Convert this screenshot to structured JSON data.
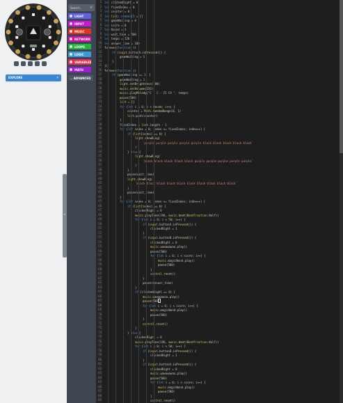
{
  "simulator": {
    "explore_label": "EXPLORE",
    "buttons": [
      "play-icon",
      "stop-icon",
      "restart-icon",
      "mute-icon",
      "fullscreen-icon"
    ],
    "device": "circuit-playground-board"
  },
  "toolbox": {
    "search_placeholder": "Search...",
    "categories": [
      {
        "label": "LIGHT",
        "color": "#6160e5"
      },
      {
        "label": "INPUT",
        "color": "#c41bd1"
      },
      {
        "label": "MUSIC",
        "color": "#e63022"
      },
      {
        "label": "NETWORK",
        "color": "#ce149e"
      },
      {
        "label": "LOOPS",
        "color": "#20b53f"
      },
      {
        "label": "LOGIC",
        "color": "#3e9ad6"
      },
      {
        "label": "VARIABLES",
        "color": "#e62e53"
      },
      {
        "label": "MATH",
        "color": "#9a1fd4"
      }
    ],
    "advanced_label": "ADVANCED"
  },
  "editor": {
    "current_line": 67,
    "code_lines": [
      {
        "indent": 0,
        "text": "let clickedRight = 0"
      },
      {
        "indent": 0,
        "text": "let fixedIndex = 0"
      },
      {
        "indent": 0,
        "text": "let counter = 0"
      },
      {
        "indent": 0,
        "text": "let list: number[] = []"
      },
      {
        "indent": 0,
        "text": "let gameWaiting = 0"
      },
      {
        "indent": 0,
        "text": "let score = 0"
      },
      {
        "indent": 0,
        "text": "let Round = 3"
      },
      {
        "indent": 0,
        "text": "let wait_time = 500"
      },
      {
        "indent": 0,
        "text": "let tempo = 120"
      },
      {
        "indent": 0,
        "text": "let answer_time = 100"
      },
      {
        "indent": 0,
        "text": "forever(function () {"
      },
      {
        "indent": 1,
        "text": "if (input.buttonA.isPressed()) {"
      },
      {
        "indent": 2,
        "text": "gameWaiting = 1"
      },
      {
        "indent": 1,
        "text": "}"
      },
      {
        "indent": 0,
        "text": "})"
      },
      {
        "indent": 0,
        "text": "forever(function () {"
      },
      {
        "indent": 1,
        "text": "if (gameWaiting == 1) {"
      },
      {
        "indent": 2,
        "text": "gameWaiting = 1"
      },
      {
        "indent": 2,
        "text": "light.setBrightness(100)"
      },
      {
        "indent": 2,
        "text": "music.setVolume(256)"
      },
      {
        "indent": 2,
        "text": "music.playMelody(\"C - C - C5 C4 \", tempo)"
      },
      {
        "indent": 2,
        "text": "pause(500)"
      },
      {
        "indent": 2,
        "text": "list = []"
      },
      {
        "indent": 2,
        "text": "for (let i = 0; i < Round; i++) {"
      },
      {
        "indent": 3,
        "text": "counter = Math.randomRange(0, 1)"
      },
      {
        "indent": 3,
        "text": "list.push(counter)"
      },
      {
        "indent": 2,
        "text": "}"
      },
      {
        "indent": 2,
        "text": "fixedIndex = list.length - 1"
      },
      {
        "indent": 2,
        "text": "for (let index = 0; index <= fixedIndex; index++) {"
      },
      {
        "indent": 3,
        "text": "if (list[index] == 0) {"
      },
      {
        "indent": 4,
        "text": "light.showRing("
      },
      {
        "indent": 5,
        "text": "`purple purple purple purple purple black black black black black`"
      },
      {
        "indent": 4,
        "text": ")"
      },
      {
        "indent": 3,
        "text": "} else {"
      },
      {
        "indent": 4,
        "text": "light.showRing("
      },
      {
        "indent": 5,
        "text": "`black black black black black purple purple purple purple purple`"
      },
      {
        "indent": 4,
        "text": ")"
      },
      {
        "indent": 3,
        "text": "}"
      },
      {
        "indent": 3,
        "text": "pause(wait_time)"
      },
      {
        "indent": 3,
        "text": "light.showRing("
      },
      {
        "indent": 4,
        "text": "`black black black black black black black black black black`"
      },
      {
        "indent": 3,
        "text": ")"
      },
      {
        "indent": 3,
        "text": "pause(wait_time)"
      },
      {
        "indent": 2,
        "text": "}"
      },
      {
        "indent": 2,
        "text": "for (let index = 0; index <= fixedIndex; index++) {"
      },
      {
        "indent": 3,
        "text": "if (list[index] == 0) {"
      },
      {
        "indent": 4,
        "text": "clickedRight = 0"
      },
      {
        "indent": 4,
        "text": "music.playTone(196, music.beat(BeatFraction.Half))"
      },
      {
        "indent": 4,
        "text": "for (let i = 0; i < 50; i++) {"
      },
      {
        "indent": 5,
        "text": "if (input.buttonA.isPressed()) {"
      },
      {
        "indent": 6,
        "text": "clickedRight = 1"
      },
      {
        "indent": 5,
        "text": "}"
      },
      {
        "indent": 5,
        "text": "if (input.buttonB.isPressed()) {"
      },
      {
        "indent": 6,
        "text": "clickedRight = 0"
      },
      {
        "indent": 6,
        "text": "music.wawawawaa.play()"
      },
      {
        "indent": 6,
        "text": "pause(500)"
      },
      {
        "indent": 6,
        "text": "for (let i = 0; i < score; i++) {"
      },
      {
        "indent": 7,
        "text": "music.magicWand.play()"
      },
      {
        "indent": 7,
        "text": "pause(500)"
      },
      {
        "indent": 6,
        "text": "}"
      },
      {
        "indent": 6,
        "text": "control.reset()"
      },
      {
        "indent": 5,
        "text": "}"
      },
      {
        "indent": 5,
        "text": "pause(answer_time)"
      },
      {
        "indent": 4,
        "text": "}"
      },
      {
        "indent": 4,
        "text": "if (clickedRight == 0) {"
      },
      {
        "indent": 5,
        "text": "music.wawawawaa.play()"
      },
      {
        "indent": 5,
        "text": "pause(500)"
      },
      {
        "indent": 5,
        "text": "for (let i = 0; i < score; i++) {"
      },
      {
        "indent": 6,
        "text": "music.magicWand.play()"
      },
      {
        "indent": 6,
        "text": "pause(500)"
      },
      {
        "indent": 5,
        "text": "}"
      },
      {
        "indent": 5,
        "text": "control.reset()"
      },
      {
        "indent": 4,
        "text": "}"
      },
      {
        "indent": 3,
        "text": "} else {"
      },
      {
        "indent": 4,
        "text": "clickedRight = 0"
      },
      {
        "indent": 4,
        "text": "music.playTone(196, music.beat(BeatFraction.Half))"
      },
      {
        "indent": 4,
        "text": "for (let i = 0; i < 50; i++) {"
      },
      {
        "indent": 5,
        "text": "if (input.buttonB.isPressed()) {"
      },
      {
        "indent": 6,
        "text": "clickedRight = 1"
      },
      {
        "indent": 5,
        "text": "}"
      },
      {
        "indent": 5,
        "text": "if (input.buttonA.isPressed()) {"
      },
      {
        "indent": 6,
        "text": "clickedRight = 0"
      },
      {
        "indent": 6,
        "text": "music.wawawawaa.play()"
      },
      {
        "indent": 6,
        "text": "pause(500)"
      },
      {
        "indent": 6,
        "text": "for (let i = 0; i < score; i++) {"
      },
      {
        "indent": 7,
        "text": "music.magicWand.play()"
      },
      {
        "indent": 7,
        "text": "pause(500)"
      },
      {
        "indent": 6,
        "text": "}"
      },
      {
        "indent": 6,
        "text": "control.reset()"
      }
    ]
  },
  "syntax_colors": {
    "keyword": "#569cd6",
    "function": "#dcdcaa",
    "number": "#b5cea8",
    "string": "#ce9178",
    "variable": "#c8c8c8",
    "member": "#e0c96a",
    "punctuation": "#d4d4d4"
  }
}
